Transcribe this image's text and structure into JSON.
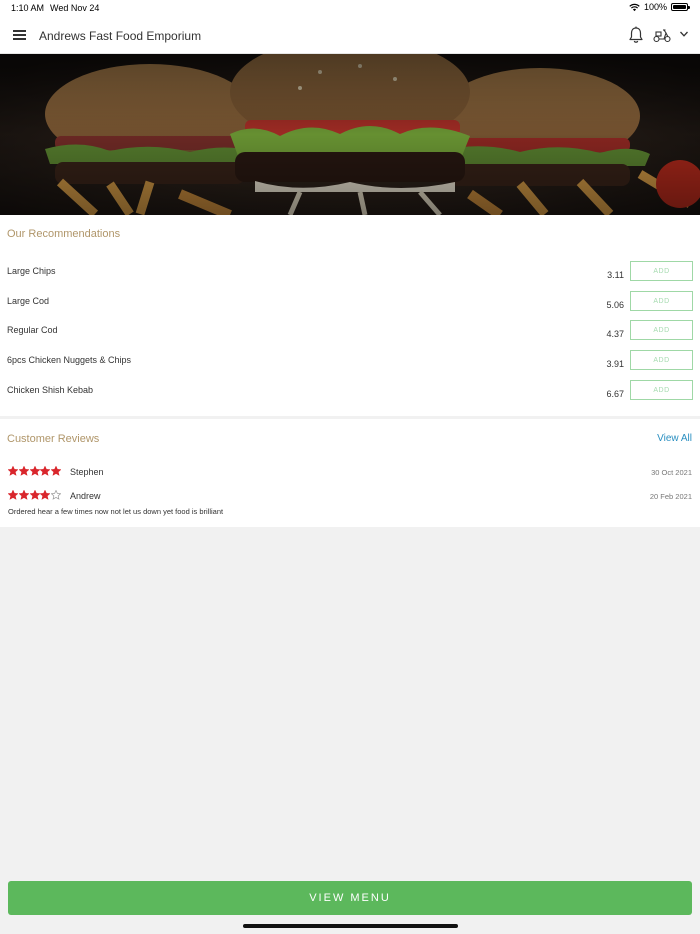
{
  "status_bar": {
    "time": "1:10 AM",
    "date": "Wed Nov 24",
    "battery": "100%",
    "wifi_icon": "wifi-icon",
    "battery_icon": "battery-icon"
  },
  "nav": {
    "menu_icon": "hamburger-menu-icon",
    "title": "Andrews Fast Food Emporium",
    "notification_icon": "bell-icon",
    "delivery_icon": "scooter-icon",
    "dropdown_icon": "chevron-down-icon"
  },
  "hero": {
    "image": "burgers-and-fries-photo"
  },
  "recommendations": {
    "title": "Our Recommendations",
    "add_label": "ADD",
    "items": [
      {
        "name": "Large Chips",
        "price": "3.11"
      },
      {
        "name": "Large Cod",
        "price": "5.06"
      },
      {
        "name": "Regular Cod",
        "price": "4.37"
      },
      {
        "name": "6pcs Chicken Nuggets & Chips",
        "price": "3.91"
      },
      {
        "name": "Chicken Shish Kebab",
        "price": "6.67"
      }
    ]
  },
  "reviews": {
    "title": "Customer Reviews",
    "view_all": "View All",
    "star_color": "#d9262c",
    "items": [
      {
        "reviewer": "Stephen",
        "rating": 5,
        "date": "30 Oct 2021",
        "comment": ""
      },
      {
        "reviewer": "Andrew",
        "rating": 4,
        "date": "20 Feb 2021",
        "comment": "Ordered hear a few times now not let us down yet food is brilliant"
      }
    ]
  },
  "footer": {
    "view_menu_label": "VIEW MENU",
    "accent": "#5cb85c"
  }
}
